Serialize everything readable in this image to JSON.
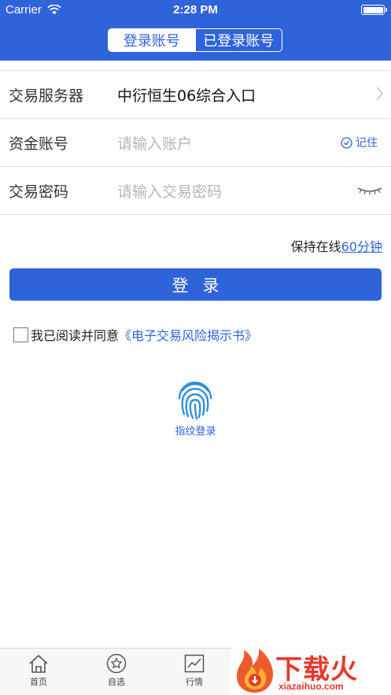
{
  "status_bar": {
    "carrier": "Carrier",
    "time": "2:28 PM"
  },
  "header": {
    "tabs": [
      {
        "label": "登录账号",
        "selected": true
      },
      {
        "label": "已登录账号",
        "selected": false
      }
    ]
  },
  "form": {
    "server": {
      "label": "交易服务器",
      "value": "中衍恒生06综合入口"
    },
    "account": {
      "label": "资金账号",
      "placeholder": "请输入账户",
      "remember_label": "记住"
    },
    "password": {
      "label": "交易密码",
      "placeholder": "请输入交易密码"
    }
  },
  "keep_online": {
    "prefix": "保持在线",
    "duration": "60分钟"
  },
  "login_button": "登录",
  "agreement": {
    "text": "我已阅读并同意",
    "link": "《电子交易风险揭示书》"
  },
  "fingerprint": {
    "label": "指纹登录"
  },
  "tab_bar": [
    {
      "label": "首页",
      "icon": "home-icon"
    },
    {
      "label": "自选",
      "icon": "star-icon"
    },
    {
      "label": "行情",
      "icon": "chart-icon"
    }
  ],
  "watermark": {
    "title": "下载火",
    "subtitle": "xiazaihuo.com"
  },
  "colors": {
    "primary": "#2f63d9",
    "watermark": "#e8382c"
  }
}
